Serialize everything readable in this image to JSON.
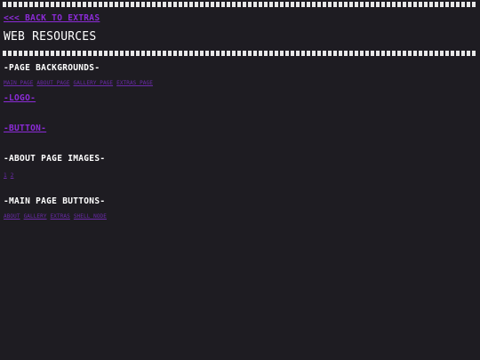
{
  "nav": {
    "back_label": "<<< BACK TO EXTRAS"
  },
  "page": {
    "title": "WEB RESOURCES"
  },
  "sections": {
    "backgrounds": {
      "heading": "-PAGE BACKGROUNDS-",
      "links": [
        "MAIN PAGE",
        "ABOUT PAGE",
        "GALLERY PAGE",
        "EXTRAS PAGE"
      ]
    },
    "logo": {
      "label": "-LOGO-"
    },
    "button": {
      "label": "-BUTTON-"
    },
    "about_images": {
      "heading": "-ABOUT PAGE IMAGES-",
      "links": [
        "1",
        "2"
      ]
    },
    "main_buttons": {
      "heading": "-MAIN PAGE BUTTONS-",
      "links": [
        "ABOUT",
        "GALLERY",
        "EXTRAS",
        "SHELL NODE"
      ]
    }
  },
  "colors": {
    "background": "#1e1c22",
    "link": "#8b2bd6",
    "text": "#ffffff",
    "divider": "#e8e8e8"
  }
}
